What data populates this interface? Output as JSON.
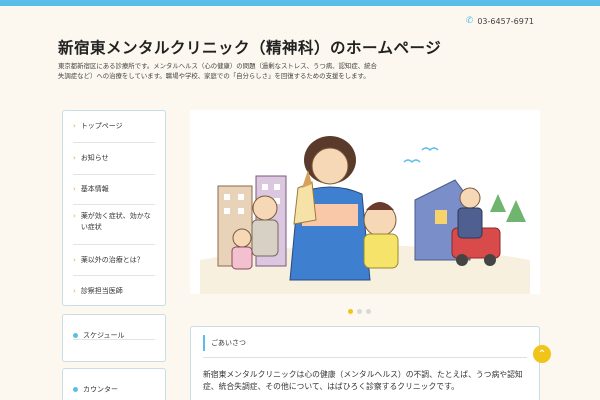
{
  "header": {
    "phone": "03-6457-6971",
    "phone_icon": "phone-icon",
    "title": "新宿東メンタルクリニック（精神科）のホームページ",
    "description": "東京都新宿区にある診療所です。メンタルヘルス（心の健康）の問題（過剰なストレス、うつ病、認知症、統合失調症など）への治療をしています。職場や学校、家庭での「自分らしさ」を回復するための支援をします。"
  },
  "nav": {
    "items": [
      {
        "label": "トップページ"
      },
      {
        "label": "お知らせ"
      },
      {
        "label": "基本情報"
      },
      {
        "label": "薬が効く症状、効かない症状"
      },
      {
        "label": "薬以外の治療とは？"
      },
      {
        "label": "診察担当医師"
      }
    ]
  },
  "sidebar": {
    "schedule": "スケジュール",
    "counter": "カウンター"
  },
  "slider": {
    "count": 3,
    "active_index": 0
  },
  "greeting": {
    "title": "ごあいさつ",
    "text": "新宿東メンタルクリニックは心の健康（メンタルヘルス）の不調、たとえば、うつ病や認知症、統合失調症、その他について、はばひろく診察するクリニックです。"
  },
  "colors": {
    "accent": "#5bbde8",
    "highlight": "#f0c419",
    "background": "#fdf8ef"
  }
}
